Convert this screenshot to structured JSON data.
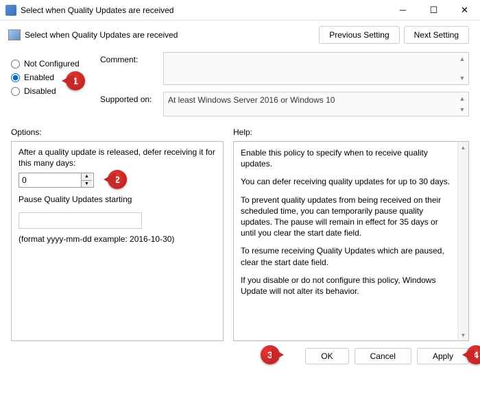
{
  "window": {
    "title": "Select when Quality Updates are received"
  },
  "header": {
    "title": "Select when Quality Updates are received",
    "prev_btn": "Previous Setting",
    "next_btn": "Next Setting"
  },
  "radios": {
    "not_configured": "Not Configured",
    "enabled": "Enabled",
    "disabled": "Disabled"
  },
  "meta": {
    "comment_label": "Comment:",
    "comment_value": "",
    "supported_label": "Supported on:",
    "supported_value": "At least Windows Server 2016 or Windows 10"
  },
  "options": {
    "label": "Options:",
    "defer_text": "After a quality update is released, defer receiving it for this many days:",
    "defer_value": "0",
    "pause_label": "Pause Quality Updates starting",
    "pause_value": "",
    "format_hint": "(format yyyy-mm-dd example: 2016-10-30)"
  },
  "help": {
    "label": "Help:",
    "p1": "Enable this policy to specify when to receive quality updates.",
    "p2": "You can defer receiving quality updates for up to 30 days.",
    "p3": "To prevent quality updates from being received on their scheduled time, you can temporarily pause quality updates. The pause will remain in effect for 35 days or until you clear the start date field.",
    "p4": "To resume receiving Quality Updates which are paused, clear the start date field.",
    "p5": "If you disable or do not configure this policy, Windows Update will not alter its behavior."
  },
  "footer": {
    "ok": "OK",
    "cancel": "Cancel",
    "apply": "Apply"
  },
  "callouts": {
    "c1": "1",
    "c2": "2",
    "c3": "3",
    "c4": "4"
  }
}
